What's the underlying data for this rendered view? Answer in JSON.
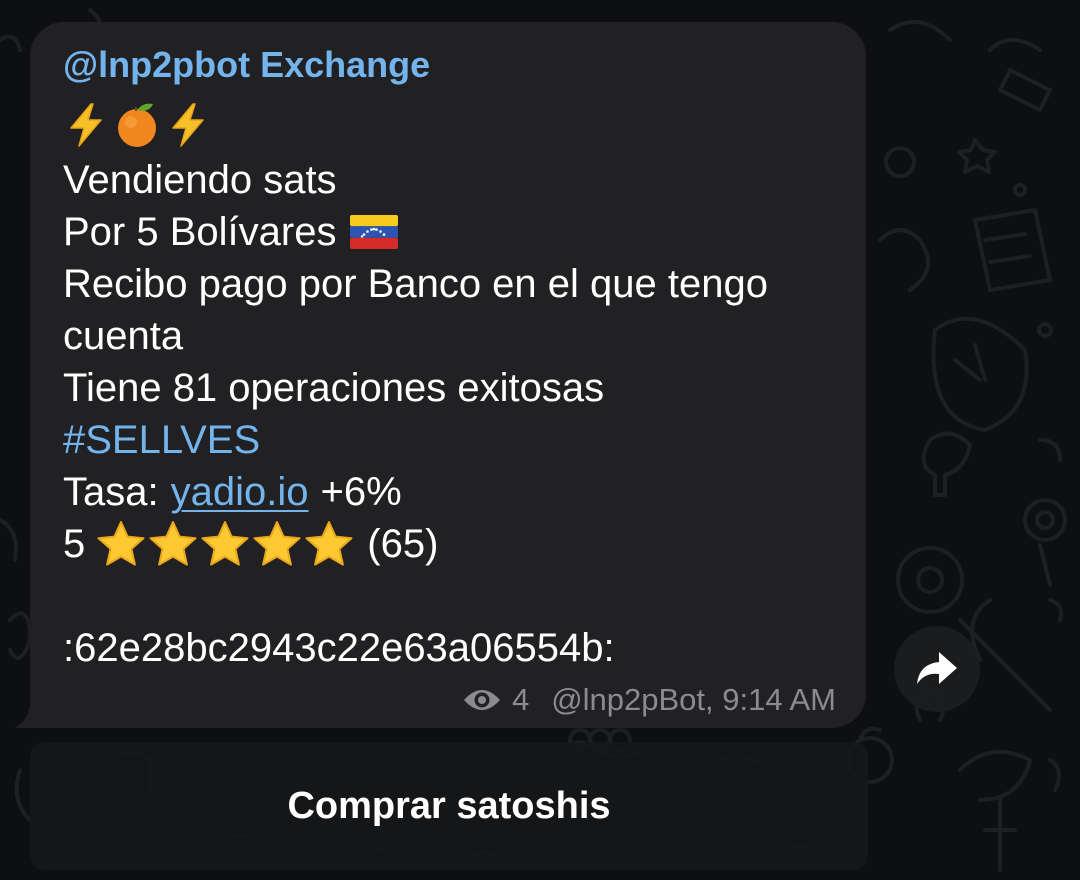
{
  "message": {
    "sender": "@lnp2pbot Exchange",
    "emojis": [
      "high-voltage",
      "tangerine",
      "high-voltage"
    ],
    "line1": "Vendiendo sats",
    "line2_text": "Por 5 Bolívares",
    "line2_flag": "venezuela-flag",
    "line3": "Recibo pago por Banco en el que tengo",
    "line4": "cuenta",
    "line5": "Tiene 81 operaciones exitosas",
    "hashtag": "#SELLVES",
    "rate_label": "Tasa:",
    "rate_link": "yadio.io",
    "rate_suffix": "+6%",
    "rating_value": "5",
    "rating_stars": 5,
    "rating_count": "(65)",
    "order_id": ":62e28bc2943c22e63a06554b:"
  },
  "meta": {
    "views": "4",
    "author_time": "@lnp2pBot, 9:14 AM"
  },
  "actions": {
    "forward_icon": "share-arrow-icon",
    "inline_button": "Comprar satoshis"
  },
  "colors": {
    "background": "#0e0f11",
    "bubble": "#212123",
    "accent": "#74b4ec",
    "text": "#ffffff",
    "meta": "#8a8b8f"
  }
}
